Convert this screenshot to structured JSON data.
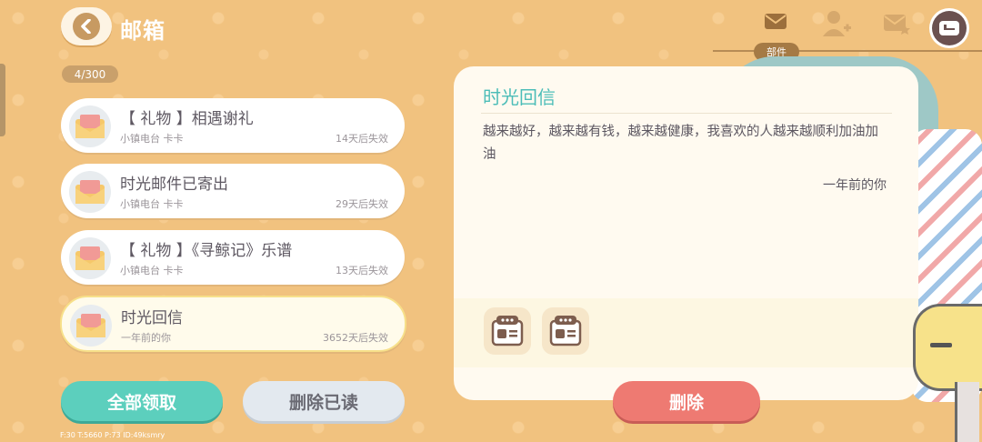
{
  "header": {
    "title": "邮箱",
    "mail_count": "4/300"
  },
  "top_tabs": {
    "active_label": "部件"
  },
  "colors": {
    "background": "#f1c27f",
    "accent_teal": "#5ccfbd",
    "delete_red": "#ee7a72",
    "title_teal": "#4cbdb8"
  },
  "mails": [
    {
      "title": "【 礼物 】相遇谢礼",
      "sender": "小镇电台 卡卡",
      "expiry": "14天后失效"
    },
    {
      "title": "时光邮件已寄出",
      "sender": "小镇电台 卡卡",
      "expiry": "29天后失效"
    },
    {
      "title": "【 礼物 】《寻鲸记》乐谱",
      "sender": "小镇电台 卡卡",
      "expiry": "13天后失效"
    },
    {
      "title": "时光回信",
      "sender": "一年前的你",
      "expiry": "3652天后失效"
    }
  ],
  "buttons": {
    "claim_all": "全部领取",
    "delete_read": "删除已读",
    "delete": "删除"
  },
  "letter": {
    "title": "时光回信",
    "body": "越来越好，越来越有钱，越来越健康，我喜欢的人越来越顺利加油加油",
    "signature": "一年前的你"
  },
  "debug": "F:30  T:5660  P:73  ID:49ksmry"
}
